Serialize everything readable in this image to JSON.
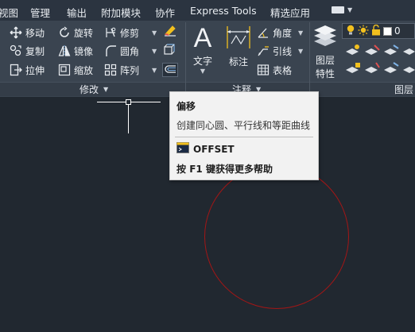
{
  "menu": {
    "items": [
      "视图",
      "管理",
      "输出",
      "附加模块",
      "协作",
      "Express Tools",
      "精选应用"
    ]
  },
  "modify": {
    "col1": [
      "移动",
      "复制",
      "拉伸"
    ],
    "col2": [
      "旋转",
      "镜像",
      "缩放"
    ],
    "col3": [
      "修剪",
      "圆角",
      "阵列"
    ],
    "title": "修改"
  },
  "annotation": {
    "text_label": "文字",
    "dim_label": "标注",
    "angle_label": "角度",
    "leader_label": "引线",
    "table_label": "表格",
    "title": "注释"
  },
  "layers": {
    "properties_label_line1": "图层",
    "properties_label_line2": "特性",
    "current_layer": "0",
    "title": "图层"
  },
  "tooltip": {
    "title": "偏移",
    "description": "创建同心圆、平行线和等距曲线",
    "command": "OFFSET",
    "help_prefix": "按",
    "help_key": "F1",
    "help_suffix": "键获得更多帮助"
  },
  "colors": {
    "background": "#212830",
    "ribbon": "#3a4450",
    "circle": "#a31616",
    "accent_yellow": "#f2c01e"
  }
}
